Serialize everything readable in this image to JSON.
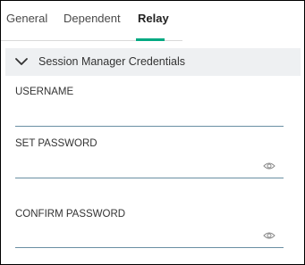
{
  "tabs": [
    {
      "label": "General"
    },
    {
      "label": "Dependent"
    },
    {
      "label": "Relay",
      "active": true
    }
  ],
  "section": {
    "title": "Session Manager Credentials",
    "icon": "chevron-down-icon",
    "expanded": true
  },
  "fields": {
    "username": {
      "label": "USERNAME",
      "value": ""
    },
    "set_password": {
      "label": "SET PASSWORD",
      "value": "",
      "icon": "eye-icon"
    },
    "confirm_password": {
      "label": "CONFIRM PASSWORD",
      "value": "",
      "icon": "eye-icon"
    }
  },
  "colors": {
    "accent": "#01a982",
    "section_bg": "#eef0f2",
    "input_underline": "#6a8fa3"
  }
}
